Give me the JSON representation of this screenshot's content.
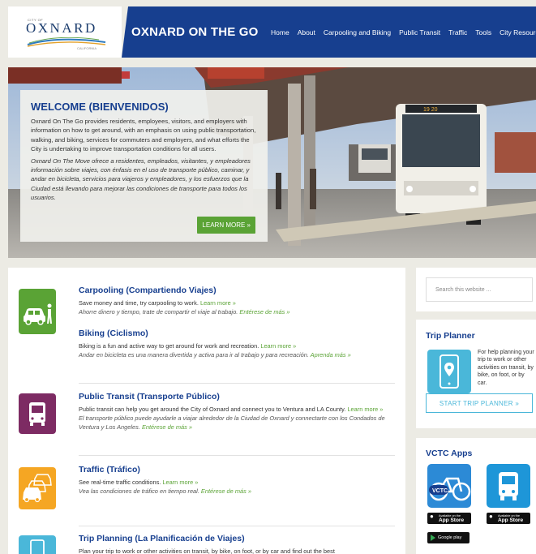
{
  "logo": {
    "small": "CITY OF",
    "name": "OXNARD",
    "sub": "CALIFORNIA"
  },
  "header": {
    "title": "OXNARD ON THE GO",
    "nav": [
      "Home",
      "About",
      "Carpooling and Biking",
      "Public Transit",
      "Traffic",
      "Tools",
      "City Resources"
    ]
  },
  "hero": {
    "bus_number": "19 20",
    "title": "WELCOME (BIENVENIDOS)",
    "text_en": "Oxnard On The Go provides residents, employees, visitors, and employers with information on how to get around, with an emphasis on using public transportation, walking, and biking, services for commuters and employers, and what efforts the City is undertaking to improve transportation conditions for all users.",
    "text_es": "Oxnard On The Move ofrece a residentes, empleados, visitantes, y empleadores información sobre viajes, con énfasis en el uso de transporte público, caminar, y andar en bicicleta, servicios para viajeros y empleadores, y los esfuerzos que la Ciudad está llevando para mejorar las condiciones de transporte para todos los usuarios.",
    "button": "LEARN MORE »"
  },
  "colors": {
    "nav_blue": "#173f8f",
    "green": "#5aa335",
    "purple": "#7d2b63",
    "orange": "#f5a623",
    "teal": "#4ab7d9"
  },
  "items": [
    {
      "title": "Carpooling (Compartiendo Viajes)",
      "en": "Save money and time, try carpooling to work.",
      "en_link": "Learn more »",
      "es": "Ahorre dinero y tiempo, trate de compartir el viaje al trabajo.",
      "es_link": "Entérese de más »",
      "icon": "car-and-pedestrian-icon"
    },
    {
      "title": "Biking (Ciclismo)",
      "en": "Biking is a fun and active way to get around for work and recreation.",
      "en_link": "Learn more »",
      "es": "Andar en bicicleta es una manera divertida y activa para ir al trabajo y para recreación.",
      "es_link": "Aprenda más »"
    },
    {
      "title": "Public Transit (Transporte Público)",
      "en": "Public transit can help you get around the City of Oxnard and connect you to Ventura and LA County.",
      "en_link": "Learn more »",
      "es": "El transporte público puede ayudarle a viajar alrededor de la Ciudad de Oxnard y connectarte con los Condados de Ventura y Los Angeles.",
      "es_link": "Entérese de más »",
      "icon": "bus-icon"
    },
    {
      "title": "Traffic (Tráfico)",
      "en": "See real-time traffic conditions.",
      "en_link": "Learn more »",
      "es": "Vea las condiciones de tráfico en tiempo real.",
      "es_link": "Entérese de más »",
      "icon": "traffic-cars-icon"
    },
    {
      "title": "Trip Planning (La Planificación de Viajes)",
      "en": "Plan your trip to work or other activities on transit, by bike, on foot, or by car and find out the best",
      "icon": "phone-map-pin-icon"
    }
  ],
  "sidebar": {
    "search_placeholder": "Search this website ...",
    "trip_title": "Trip Planner",
    "trip_text": "For help planning your trip to work or other activities on transit, by bike, on foot, or by car.",
    "trip_button": "START TRIP PLANNER »",
    "apps_title": "VCTC Apps",
    "vctc_label": "VCTC",
    "badge_small": "Available on the",
    "badge_store": "App Store",
    "badge_play": "Google play"
  }
}
